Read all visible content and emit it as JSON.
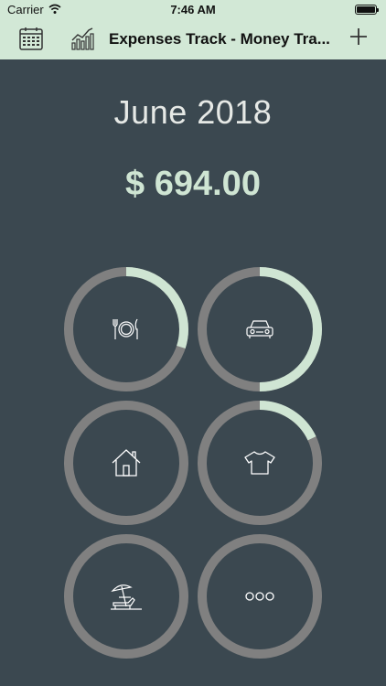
{
  "status_bar": {
    "carrier": "Carrier",
    "time": "7:46 AM"
  },
  "nav": {
    "title": "Expenses Track - Money Tra..."
  },
  "summary": {
    "month": "June 2018",
    "amount": "$ 694.00"
  },
  "colors": {
    "background": "#3b4850",
    "header": "#d2e8d6",
    "ring_track": "#808080",
    "ring_progress": "#cfe5d3"
  },
  "categories": [
    {
      "icon": "dining-icon",
      "progress": 0.3
    },
    {
      "icon": "car-icon",
      "progress": 0.5
    },
    {
      "icon": "house-icon",
      "progress": 0.0
    },
    {
      "icon": "tshirt-icon",
      "progress": 0.18
    },
    {
      "icon": "beach-icon",
      "progress": 0.0
    },
    {
      "icon": "more-icon",
      "progress": 0.0
    }
  ]
}
